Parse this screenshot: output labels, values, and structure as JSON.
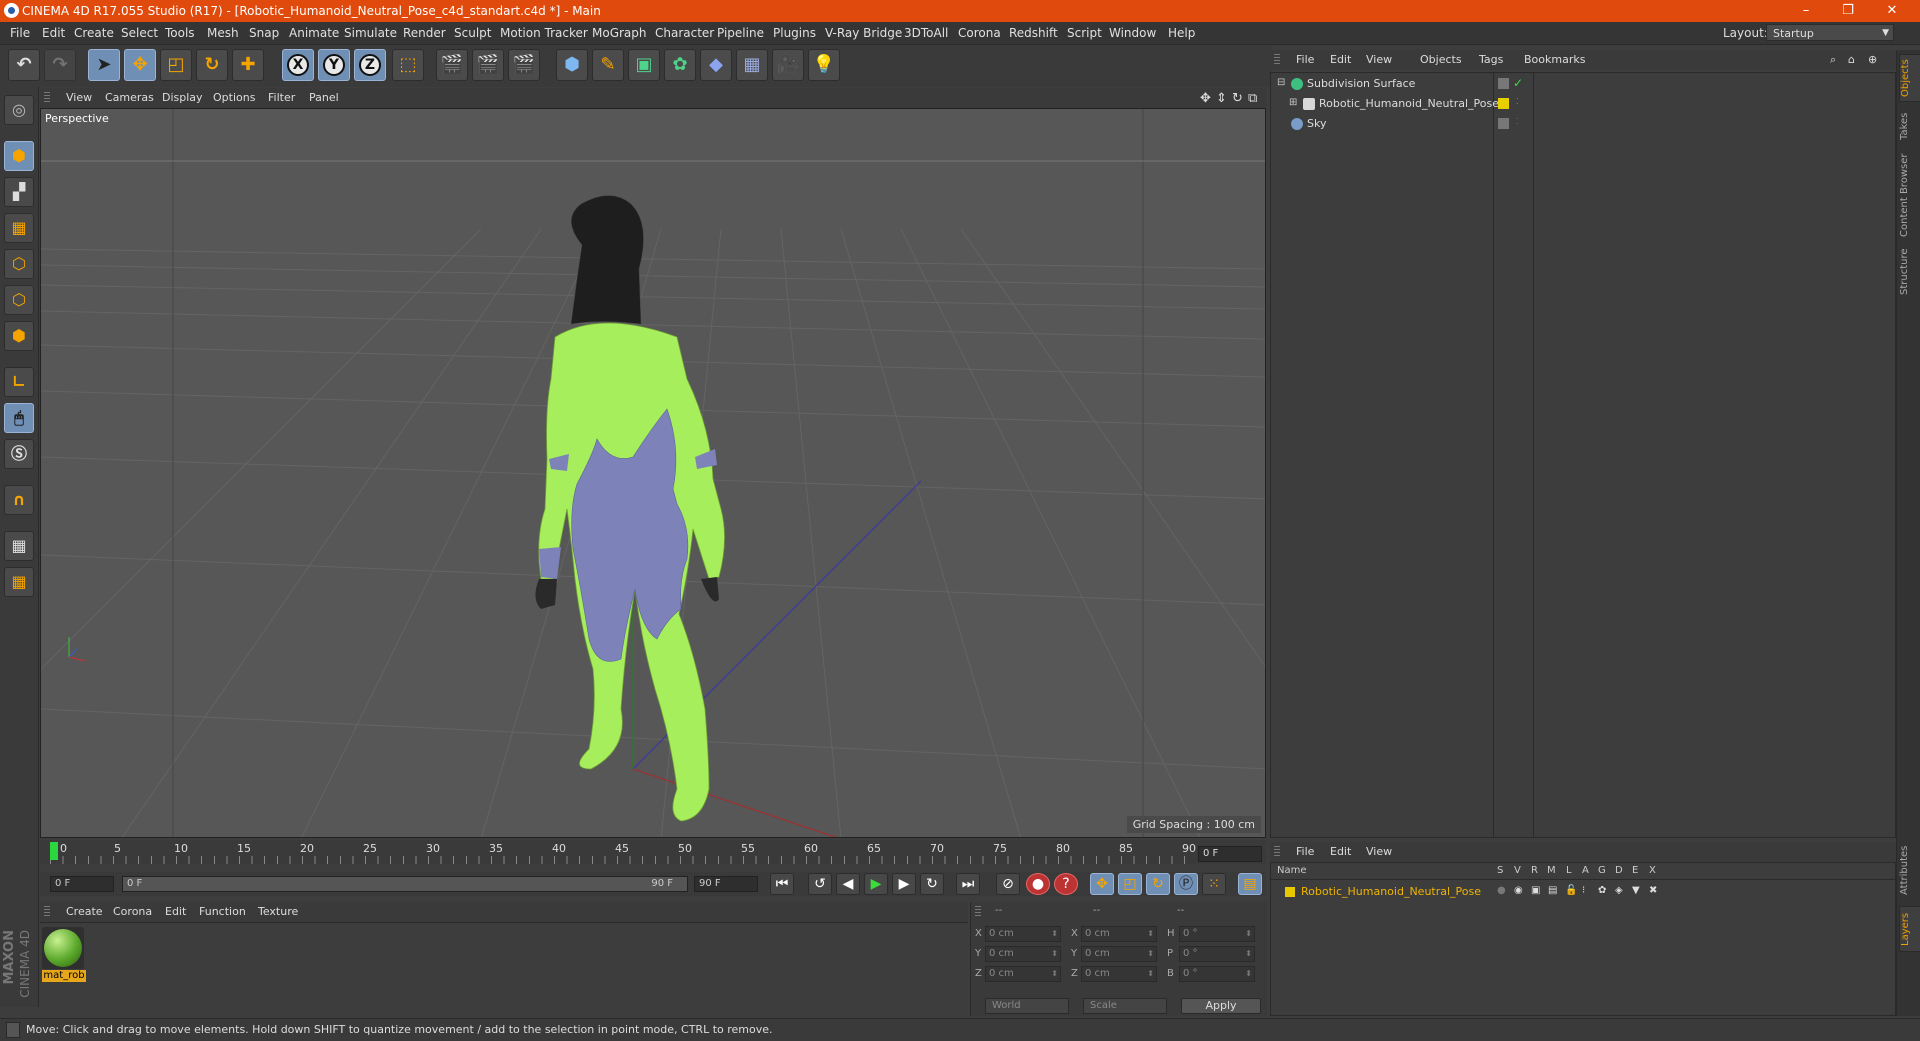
{
  "window": {
    "title": "CINEMA 4D R17.055 Studio (R17) - [Robotic_Humanoid_Neutral_Pose_c4d_standart.c4d *] - Main",
    "controls": [
      "–",
      "❐",
      "✕"
    ]
  },
  "menubar": {
    "items": [
      "File",
      "Edit",
      "Create",
      "Select",
      "Tools",
      "Mesh",
      "Snap",
      "Animate",
      "Simulate",
      "Render",
      "Sculpt",
      "Motion Tracker",
      "MoGraph",
      "Character",
      "Pipeline",
      "Plugins",
      "V-Ray Bridge",
      "3DToAll",
      "Corona",
      "Redshift",
      "Script",
      "Window",
      "Help"
    ],
    "layout_label": "Layout:",
    "layout_value": "Startup"
  },
  "toolbar": {
    "undo": "undo-icon",
    "redo": "redo-icon",
    "axis_x": "X",
    "axis_y": "Y",
    "axis_z": "Z"
  },
  "viewport": {
    "menu": [
      "View",
      "Cameras",
      "Display",
      "Options",
      "Filter",
      "Panel"
    ],
    "label": "Perspective",
    "grid_spacing": "Grid Spacing : 100 cm"
  },
  "timeline": {
    "ticks": [
      "0",
      "5",
      "10",
      "15",
      "20",
      "25",
      "30",
      "35",
      "40",
      "45",
      "50",
      "55",
      "60",
      "65",
      "70",
      "75",
      "80",
      "85",
      "90"
    ],
    "current_frame": "0 F",
    "start_field": "0 F",
    "range_start": "0 F",
    "range_end": "90 F",
    "end_field": "90 F"
  },
  "material_manager": {
    "menu": [
      "Create",
      "Corona",
      "Edit",
      "Function",
      "Texture"
    ],
    "materials": [
      {
        "name": "mat_rob",
        "color": "#7cc43c"
      }
    ]
  },
  "coordinates": {
    "headers": [
      "--",
      "--",
      "--"
    ],
    "rows": [
      {
        "l1": "X",
        "v1": "0 cm",
        "l2": "X",
        "v2": "0 cm",
        "l3": "H",
        "v3": "0 °"
      },
      {
        "l1": "Y",
        "v1": "0 cm",
        "l2": "Y",
        "v2": "0 cm",
        "l3": "P",
        "v3": "0 °"
      },
      {
        "l1": "Z",
        "v1": "0 cm",
        "l2": "Z",
        "v2": "0 cm",
        "l3": "B",
        "v3": "0 °"
      }
    ],
    "space_select": "World",
    "mode_select": "Scale",
    "apply": "Apply"
  },
  "object_manager": {
    "menu": [
      "File",
      "Edit",
      "View",
      "Objects",
      "Tags",
      "Bookmarks"
    ],
    "objects": [
      {
        "name": "Subdivision Surface",
        "icon_color": "#3fbf7f"
      },
      {
        "name": "Robotic_Humanoid_Neutral_Pose",
        "icon_color": "#d8d8d8",
        "tag_color": "#e8d000"
      },
      {
        "name": "Sky",
        "icon_color": "#7a9cc8"
      }
    ]
  },
  "layer_manager": {
    "menu": [
      "File",
      "Edit",
      "View"
    ],
    "columns": [
      "Name",
      "S",
      "V",
      "R",
      "M",
      "L",
      "A",
      "G",
      "D",
      "E",
      "X"
    ],
    "layers": [
      {
        "name": "Robotic_Humanoid_Neutral_Pose",
        "color": "#e8c800"
      }
    ]
  },
  "right_tabs": [
    "Objects",
    "Takes",
    "Content Browser",
    "Structure",
    "Attributes",
    "Layers"
  ],
  "status": {
    "text": "Move: Click and drag to move elements. Hold down SHIFT to quantize movement / add to the selection in point mode, CTRL to remove."
  },
  "branding": {
    "maxon": "MAXON",
    "cinema": "CINEMA 4D"
  },
  "colors": {
    "title_bar": "#e04a0c",
    "active_tool": "#6f8fb5",
    "suit_green": "#a6ee5c",
    "suit_purple": "#7d83b8",
    "layer_yellow": "#e8c800"
  }
}
